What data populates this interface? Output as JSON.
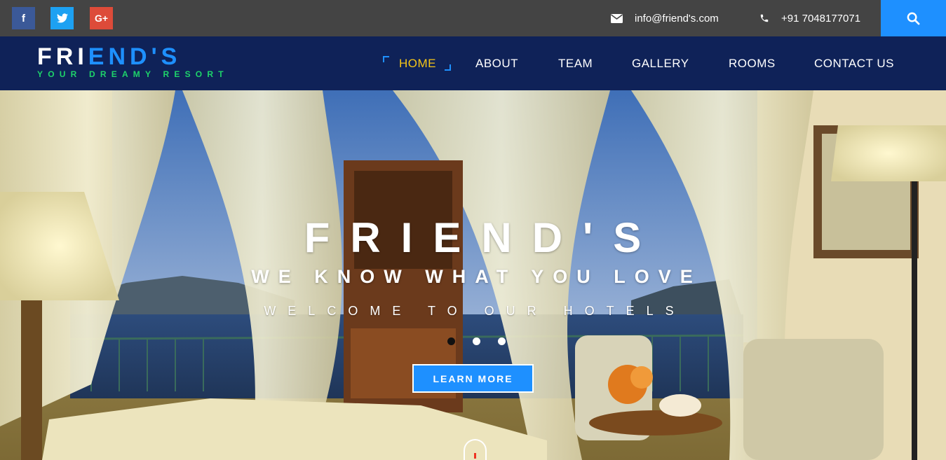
{
  "topbar": {
    "social": [
      {
        "name": "facebook",
        "glyph": "f"
      },
      {
        "name": "twitter",
        "glyph": "t"
      },
      {
        "name": "google-plus",
        "glyph": "G+"
      }
    ],
    "email": "info@friend's.com",
    "phone": "+91 7048177071",
    "search_icon": "search-icon"
  },
  "brand": {
    "name_white": "FRI",
    "name_blue": "END'S",
    "tagline": "YOUR DREAMY RESORT"
  },
  "nav": {
    "items": [
      {
        "label": "HOME",
        "active": true
      },
      {
        "label": "ABOUT",
        "active": false
      },
      {
        "label": "TEAM",
        "active": false
      },
      {
        "label": "GALLERY",
        "active": false
      },
      {
        "label": "ROOMS",
        "active": false
      },
      {
        "label": "CONTACT US",
        "active": false
      }
    ]
  },
  "hero": {
    "title": "FRIEND'S",
    "subtitle": "WE KNOW WHAT YOU LOVE",
    "welcome": "WELCOME TO OUR HOTELS",
    "slides": 3,
    "active_slide": 1,
    "cta_label": "LEARN MORE"
  },
  "colors": {
    "topbar": "#444444",
    "navbar": "#0f2258",
    "accent": "#1e90ff",
    "active_nav": "#f5c518",
    "tagline": "#1ed36a"
  }
}
